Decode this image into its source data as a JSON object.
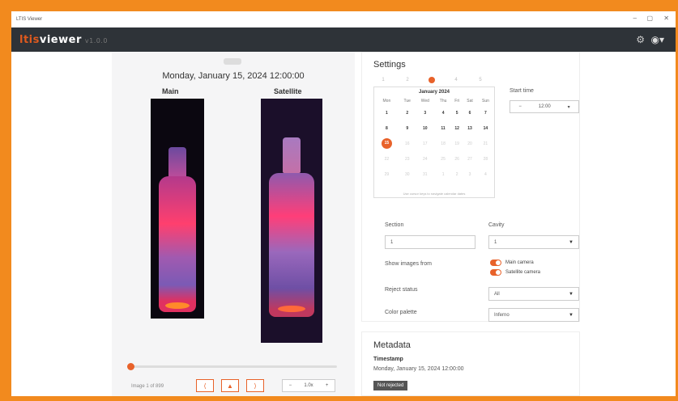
{
  "window": {
    "title": "LTIS Viewer",
    "min": "–",
    "max": "▢",
    "close": "✕"
  },
  "app": {
    "logo_prefix": "ltis",
    "logo_name": "viewer",
    "logo_version": "v1.0.0"
  },
  "viewer": {
    "datetime": "Monday, January 15, 2024 12:00:00",
    "main_label": "Main",
    "satellite_label": "Satellite",
    "image_count": "Image 1 of 899",
    "slider_position": 0.0,
    "prev_label": "⟨",
    "play_label": "▲",
    "next_label": "⟩",
    "speed_minus": "−",
    "speed_value": "1.0x",
    "speed_plus": "+"
  },
  "settings": {
    "title": "Settings",
    "steps": [
      "1",
      "2",
      "",
      "4",
      "5"
    ],
    "calendar": {
      "month": "January 2024",
      "weekdays": [
        "Mon",
        "Tue",
        "Wed",
        "Thu",
        "Fri",
        "Sat",
        "Sun"
      ],
      "weeks": [
        [
          "1",
          "2",
          "3",
          "4",
          "5",
          "6",
          "7"
        ],
        [
          "8",
          "9",
          "10",
          "11",
          "12",
          "13",
          "14"
        ],
        [
          "15",
          "16",
          "17",
          "18",
          "19",
          "20",
          "21"
        ],
        [
          "22",
          "23",
          "24",
          "25",
          "26",
          "27",
          "28"
        ],
        [
          "29",
          "30",
          "31",
          "1",
          "2",
          "3",
          "4"
        ]
      ],
      "selected": "15",
      "footer": "Use cursor keys to navigate calendar dates"
    },
    "start_time_label": "Start time",
    "start_time_minus": "−",
    "start_time_value": "12:00",
    "section_label": "Section",
    "section_value": "1",
    "cavity_label": "Cavity",
    "cavity_value": "1",
    "show_images_label": "Show images from",
    "main_camera": "Main camera",
    "satellite_camera": "Satellite camera",
    "reject_label": "Reject status",
    "reject_value": "All",
    "palette_label": "Color palette",
    "palette_value": "Inferno"
  },
  "metadata": {
    "title": "Metadata",
    "timestamp_label": "Timestamp",
    "timestamp_value": "Monday, January 15, 2024 12:00:00",
    "status_badge": "Not rejected"
  },
  "colors": {
    "accent": "#E8622A",
    "appbar": "#2E3338",
    "frame": "#F28A1E"
  }
}
